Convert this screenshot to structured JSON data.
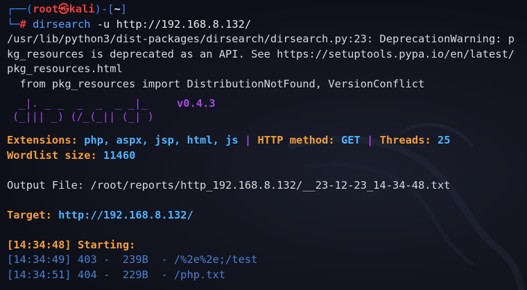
{
  "prompt": {
    "user": "root",
    "at": "㉿",
    "host": "kali",
    "dir": "~",
    "symbol": "#",
    "command": "dirsearch",
    "args": " -u http://192.168.8.132/"
  },
  "warning": [
    "/usr/lib/python3/dist-packages/dirsearch/dirsearch.py:23: DeprecationWarning: p",
    "kg_resources is deprecated as an API. See https://setuptools.pypa.io/en/latest/",
    "pkg_resources.html",
    "  from pkg_resources import DistributionNotFound, VersionConflict"
  ],
  "logo": {
    "line1": " _|. _ _  _  _  _ _|_",
    "line2": "(_||| _) (/_(_|| (_| )",
    "version": "v0.4.3"
  },
  "config": {
    "extensions_label": "Extensions:",
    "extensions_value": "php, aspx, jsp, html, js",
    "sep": "|",
    "method_label": "HTTP method:",
    "method_value": "GET",
    "threads_label": "Threads:",
    "threads_value": "25",
    "wordlist_label": "Wordlist size:",
    "wordlist_value": "11460"
  },
  "output_file": "Output File: /root/reports/http_192.168.8.132/__23-12-23_14-34-48.txt",
  "target": {
    "label": "Target:",
    "value": "http://192.168.8.132/"
  },
  "starting": {
    "time": "[14:34:48]",
    "label": "Starting:"
  },
  "results": [
    "[14:34:49] 403 -  239B  - /%2e%2e;/test",
    "[14:34:51] 404 -  229B  - /php.txt"
  ],
  "colors": {
    "background": "#0e1019",
    "prompt_blue": "#3b82f6",
    "user_red": "#ef3b3b",
    "label_orange": "#f59e3b",
    "value_blue": "#4fb3ff",
    "purple": "#a349e3"
  }
}
